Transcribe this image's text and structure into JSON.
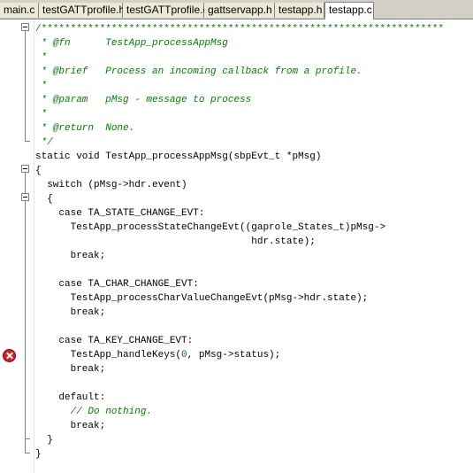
{
  "tabs": [
    {
      "label": "main.c",
      "active": false
    },
    {
      "label": "testGATTprofile.h",
      "active": false
    },
    {
      "label": "testGATTprofile.c",
      "active": false
    },
    {
      "label": "gattservapp.h",
      "active": false
    },
    {
      "label": "testapp.h",
      "active": false
    },
    {
      "label": "testapp.c",
      "active": true
    }
  ],
  "code": {
    "l1": "/*********************************************************************",
    "l2": " * @fn      TestApp_processAppMsg",
    "l3": " *",
    "l4": " * @brief   Process an incoming callback from a profile.",
    "l5": " *",
    "l6": " * @param   pMsg - message to process",
    "l7": " *",
    "l8": " * @return  None.",
    "l9": " */",
    "l10": "static void TestApp_processAppMsg(sbpEvt_t *pMsg)",
    "l11": "{",
    "l12": "  switch (pMsg->hdr.event)",
    "l13": "  {",
    "l14": "    case TA_STATE_CHANGE_EVT:",
    "l15": "      TestApp_processStateChangeEvt((gaprole_States_t)pMsg->",
    "l16": "                                     hdr.state);",
    "l17": "      break;",
    "l19": "    case TA_CHAR_CHANGE_EVT:",
    "l20": "      TestApp_processCharValueChangeEvt(pMsg->hdr.state);",
    "l21": "      break;",
    "l23": "    case TA_KEY_CHANGE_EVT:",
    "l24a": "      TestApp_handleKeys(",
    "l24b": "0",
    "l24c": ", pMsg->status);",
    "l25": "      break;",
    "l27": "    default:",
    "l28": "      // Do nothing.",
    "l29": "      break;",
    "l30": "  }",
    "l31": "}"
  },
  "error_marker_line": 24
}
